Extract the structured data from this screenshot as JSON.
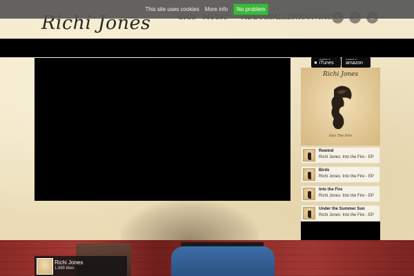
{
  "cookie_bar": {
    "text": "This site uses cookies",
    "link": "More info",
    "button": "No problem"
  },
  "header": {
    "logo": "Richi Jones",
    "nav": [
      "GIGS",
      "MUSIC",
      "VIDEOS",
      "GALLERY",
      "CONTACT"
    ],
    "social_icons": [
      "twitter-icon",
      "facebook-icon",
      "instagram-icon"
    ]
  },
  "stores": {
    "itunes_small": "Available on",
    "itunes_name": "iTunes",
    "amazon_small": "Available at",
    "amazon_name": "amazon"
  },
  "album": {
    "artist": "Richi Jones",
    "title": "Into The Fire"
  },
  "tracks": [
    {
      "title": "Rewind",
      "subtitle": "Richi Jones: Into the Fire - EP"
    },
    {
      "title": "Birds",
      "subtitle": "Richi Jones: Into the Fire - EP"
    },
    {
      "title": "Into the Fire",
      "subtitle": "Richi Jones: Into the Fire - EP"
    },
    {
      "title": "Under the Summer Sun",
      "subtitle": "Richi Jones: Into the Fire - EP"
    }
  ],
  "facebook": {
    "name": "Richi Jones",
    "likes": "1,989 likes"
  }
}
